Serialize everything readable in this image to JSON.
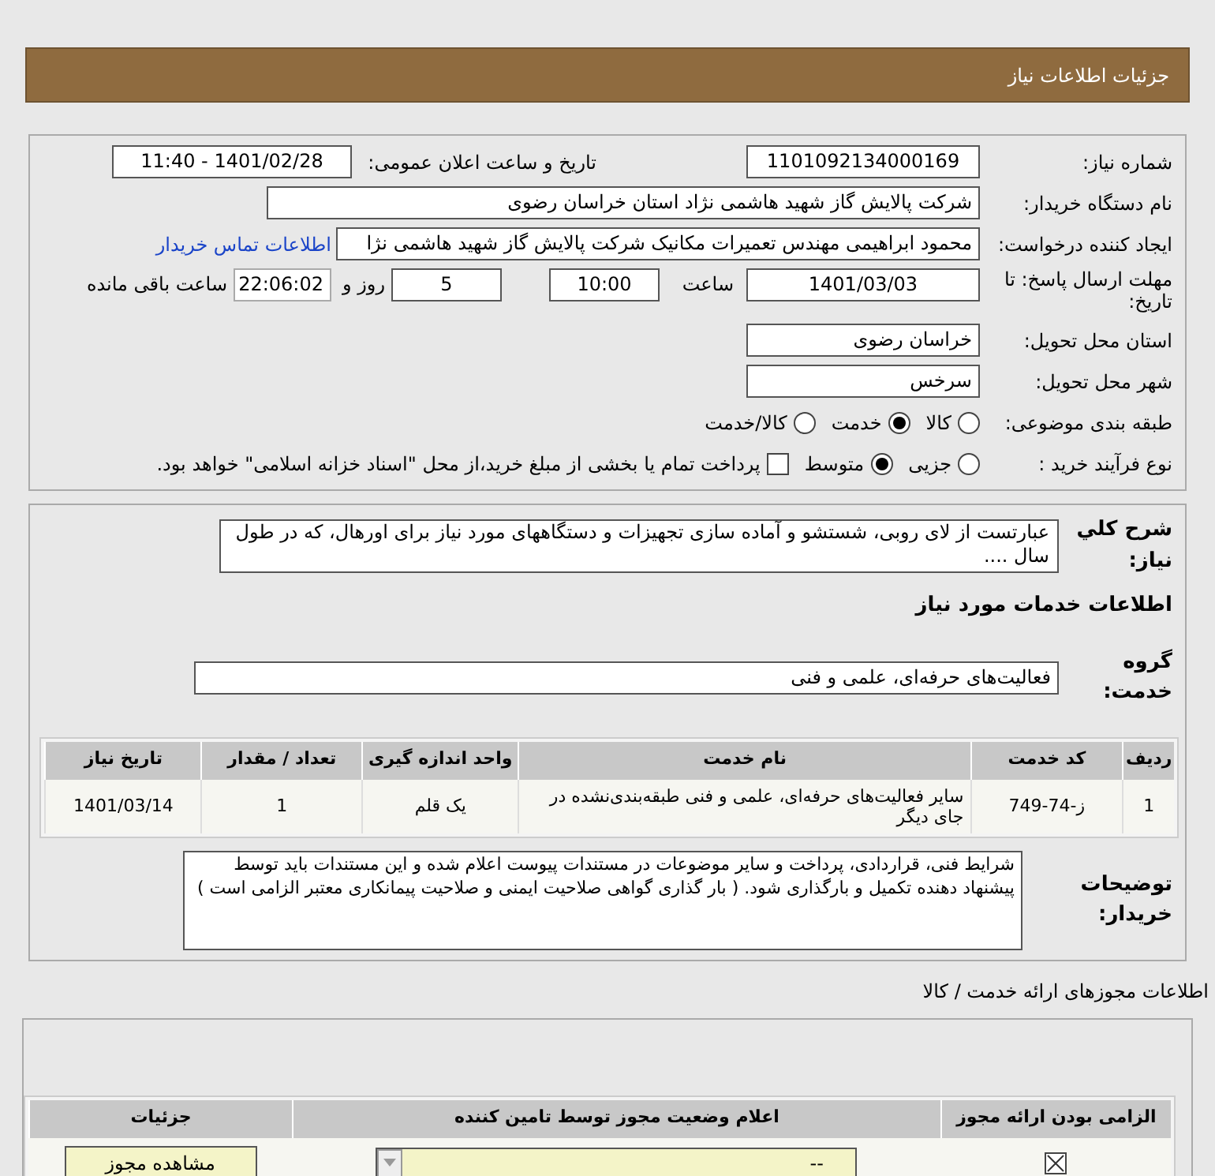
{
  "header": {
    "title": "جزئیات اطلاعات نیاز"
  },
  "need_info": {
    "need_number": {
      "label": "شماره نیاز:",
      "value": "1101092134000169"
    },
    "announce_date": {
      "label": "تاریخ و ساعت اعلان عمومی:",
      "value": "1401/02/28 - 11:40"
    },
    "buyer": {
      "label": "نام دستگاه خریدار:",
      "value": "شرکت پالایش گاز شهید هاشمی نژاد   استان خراسان رضوی"
    },
    "requester": {
      "label": "ایجاد کننده درخواست:",
      "value": "محمود ابراهیمی مهندس تعمیرات مکانیک شرکت پالایش گاز شهید هاشمی نژا",
      "link": "اطلاعات تماس خریدار"
    },
    "deadline": {
      "label": "مهلت ارسال پاسخ: تا تاریخ:",
      "date": "1401/03/03",
      "time_label": "ساعت",
      "time": "10:00",
      "days": "5",
      "days_label": "روز و",
      "remaining": "22:06:02",
      "remaining_label": "ساعت باقی مانده"
    },
    "province": {
      "label": "استان محل تحویل:",
      "value": "خراسان رضوی"
    },
    "city": {
      "label": "شهر محل تحویل:",
      "value": "سرخس"
    },
    "category": {
      "label": "طبقه بندی موضوعی:",
      "options": [
        {
          "label": "کالا",
          "selected": false
        },
        {
          "label": "خدمت",
          "selected": true
        },
        {
          "label": "کالا/خدمت",
          "selected": false
        }
      ]
    },
    "purchase": {
      "label": "نوع فرآیند خرید :",
      "options": [
        {
          "kind": "radio",
          "label": "جزیی",
          "selected": false
        },
        {
          "kind": "radio",
          "label": "متوسط",
          "selected": true
        },
        {
          "kind": "checkbox",
          "label": "پرداخت تمام یا بخشی از مبلغ خرید،از محل \"اسناد خزانه اسلامی\" خواهد بود.",
          "checked": false
        }
      ]
    }
  },
  "description": {
    "label": "شرح کلي نياز:",
    "value": "عبارتست از لای روبی، شستشو و آماده سازی تجهیزات و دستگاههای مورد نیاز برای اورهال، که در طول سال ...."
  },
  "services": {
    "title": "اطلاعات خدمات مورد نياز",
    "group_label": "گروه خدمت:",
    "group_value": "فعالیت‌های حرفه‌ای، علمی و فنی",
    "columns": [
      "ردیف",
      "کد خدمت",
      "نام خدمت",
      "واحد اندازه گیری",
      "تعداد / مقدار",
      "تاریخ نیاز"
    ],
    "rows": [
      [
        "1",
        "ز-74-749",
        "سایر فعالیت‌های حرفه‌ای، علمی و فنی طبقه‌بندی‌نشده در جای دیگر",
        "یک قلم",
        "1",
        "1401/03/14"
      ]
    ]
  },
  "buyer_notes": {
    "label": "توضیحات خریدار:",
    "value": "شرایط فنی، قراردادی، پرداخت و سایر موضوعات در مستندات پیوست اعلام شده و این مستندات باید توسط پیشنهاد دهنده تکمیل و  بارگذاری شود. ( بار گذاری گواهی صلاحیت ایمنی و صلاحیت پیمانکاری معتبر الزامی است )"
  },
  "licenses": {
    "title": "اطلاعات مجوزهای ارائه خدمت / کالا",
    "columns": [
      "الزامی بودن ارائه مجوز",
      "اعلام وضعیت مجوز توسط تامین کننده",
      "جزئیات"
    ],
    "rows": [
      {
        "required": true,
        "status": "--",
        "button": "مشاهده مجوز"
      }
    ]
  }
}
